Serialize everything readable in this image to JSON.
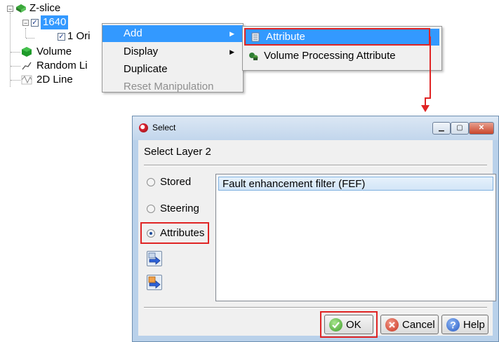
{
  "tree": {
    "items": [
      {
        "label": "Z-slice"
      },
      {
        "label": "1640"
      },
      {
        "label": "1 Ori"
      },
      {
        "label": "Volume"
      },
      {
        "label": "Random Li"
      },
      {
        "label": "2D Line"
      }
    ]
  },
  "context_menu": {
    "items": [
      {
        "label": "Add",
        "submenu": true
      },
      {
        "label": "Display",
        "submenu": true
      },
      {
        "label": "Duplicate"
      },
      {
        "label": "Reset Manipulation",
        "disabled": true
      }
    ]
  },
  "submenu": {
    "items": [
      {
        "label": "Attribute"
      },
      {
        "label": "Volume Processing Attribute"
      }
    ]
  },
  "dialog": {
    "title": "Select",
    "heading": "Select Layer 2",
    "options": [
      {
        "label": "Stored",
        "checked": false
      },
      {
        "label": "Steering",
        "checked": false
      },
      {
        "label": "Attributes",
        "checked": true
      }
    ],
    "list_items": [
      "Fault enhancement filter (FEF)"
    ],
    "selected_item": "Fault enhancement filter (FEF)",
    "buttons": {
      "ok": "OK",
      "cancel": "Cancel",
      "help": "Help"
    }
  },
  "colors": {
    "highlight": "#3399ff",
    "annotation": "#e02424"
  }
}
